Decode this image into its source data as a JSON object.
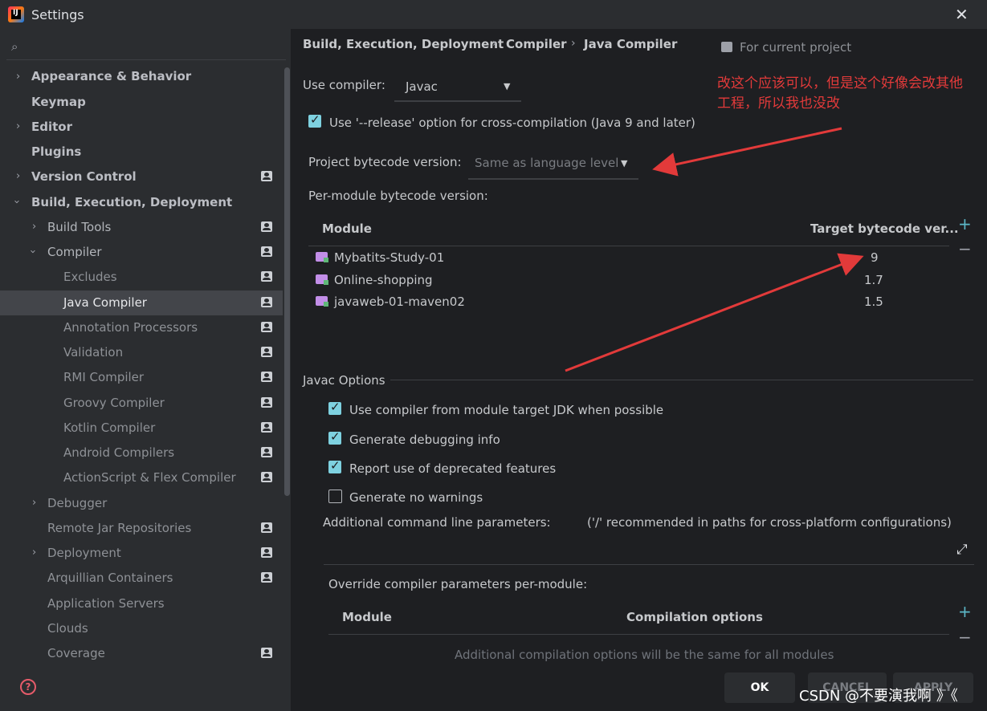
{
  "window": {
    "title": "Settings",
    "close_glyph": "✕"
  },
  "sidebar": {
    "items": [
      {
        "label": "Appearance & Behavior"
      },
      {
        "label": "Keymap"
      },
      {
        "label": "Editor"
      },
      {
        "label": "Plugins"
      },
      {
        "label": "Version Control"
      },
      {
        "label": "Build, Execution, Deployment"
      },
      {
        "label": "Build Tools"
      },
      {
        "label": "Compiler"
      },
      {
        "label": "Excludes"
      },
      {
        "label": "Java Compiler"
      },
      {
        "label": "Annotation Processors"
      },
      {
        "label": "Validation"
      },
      {
        "label": "RMI Compiler"
      },
      {
        "label": "Groovy Compiler"
      },
      {
        "label": "Kotlin Compiler"
      },
      {
        "label": "Android Compilers"
      },
      {
        "label": "ActionScript & Flex Compiler"
      },
      {
        "label": "Debugger"
      },
      {
        "label": "Remote Jar Repositories"
      },
      {
        "label": "Deployment"
      },
      {
        "label": "Arquillian Containers"
      },
      {
        "label": "Application Servers"
      },
      {
        "label": "Clouds"
      },
      {
        "label": "Coverage"
      }
    ]
  },
  "breadcrumb": [
    "Build, Execution, Deployment",
    "Compiler",
    "Java Compiler"
  ],
  "breadcrumb_sep": "›",
  "scope_label": "For current project",
  "use_compiler": {
    "label": "Use compiler:",
    "value": "Javac"
  },
  "release_option": {
    "label": "Use '--release' option for cross-compilation (Java 9 and later)",
    "checked": true
  },
  "project_bytecode": {
    "label": "Project bytecode version:",
    "value": "Same as language level"
  },
  "per_module_label": "Per-module bytecode version:",
  "module_table": {
    "headers": [
      "Module",
      "Target bytecode ver..."
    ],
    "rows": [
      {
        "module": "Mybatits-Study-01",
        "target": "9"
      },
      {
        "module": "Online-shopping",
        "target": "1.7"
      },
      {
        "module": "javaweb-01-maven02",
        "target": "1.5"
      }
    ]
  },
  "javac_options": {
    "title": "Javac Options",
    "checks": [
      {
        "label": "Use compiler from module target JDK when possible",
        "checked": true
      },
      {
        "label": "Generate debugging info",
        "checked": true
      },
      {
        "label": "Report use of deprecated features",
        "checked": true
      },
      {
        "label": "Generate no warnings",
        "checked": false
      }
    ],
    "additional_params_label": "Additional command line parameters:",
    "additional_params_hint": "('/' recommended in paths for cross-platform configurations)",
    "override_label": "Override compiler parameters per-module:",
    "override_headers": [
      "Module",
      "Compilation options"
    ],
    "override_empty": "Additional compilation options will be the same for all modules"
  },
  "buttons": {
    "ok": "OK",
    "cancel": "CANCEL",
    "apply": "APPLY"
  },
  "annotation": {
    "line1": "改这个应该可以，但是这个好像会改其他",
    "line2": "工程，所以我也没改",
    "color": "#e23a3a"
  },
  "watermark": "CSDN @不要演我啊 》《",
  "colors": {
    "accent": "#7ed1e0",
    "selection": "#43454a"
  }
}
